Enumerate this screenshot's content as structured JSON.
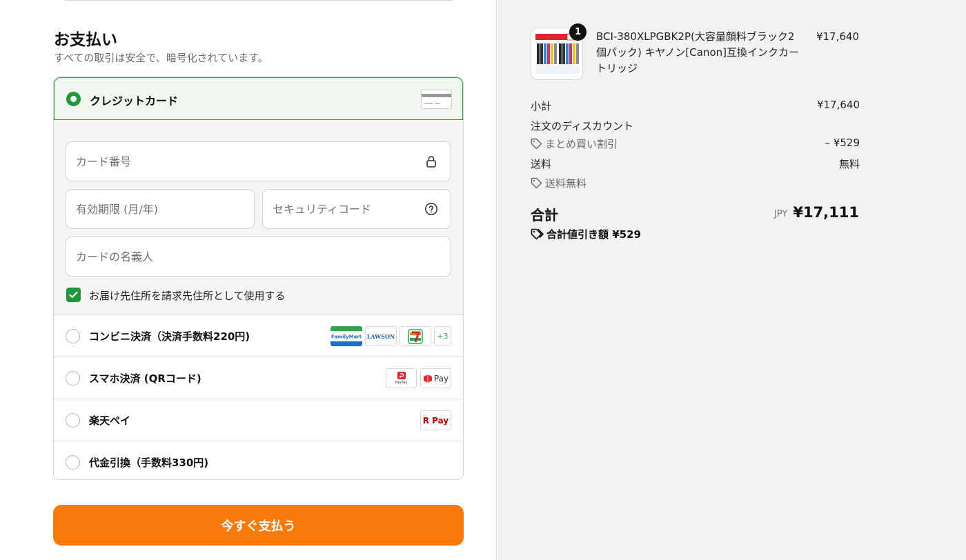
{
  "payment": {
    "title": "お支払い",
    "subtitle": "すべての取引は安全で、暗号化されています。",
    "credit_card": {
      "label": "クレジットカード",
      "card_number_placeholder": "カード番号",
      "expiry_placeholder": "有効期限 (月/年)",
      "cvc_placeholder": "セキュリティコード",
      "name_placeholder": "カードの名義人",
      "billing_same_label": "お届け先住所を請求先住所として使用する"
    },
    "options": [
      {
        "label": "コンビニ決済（決済手数料220円)",
        "logos": [
          "FamilyMart",
          "LAWSON",
          "7-Eleven",
          "+3"
        ]
      },
      {
        "label": "スマホ決済 (QRコード)",
        "logos": [
          "PayPay",
          "Pay"
        ]
      },
      {
        "label": "楽天ペイ",
        "logos": [
          "R Pay"
        ]
      },
      {
        "label": "代金引換（手数料330円)",
        "logos": []
      }
    ],
    "pay_button": "今すぐ支払う"
  },
  "summary": {
    "item": {
      "quantity": "1",
      "name": "BCI-380XLPGBK2P(大容量顔料ブラック2個パック) キヤノン[Canon]互換インクカートリッジ",
      "price": "¥17,640"
    },
    "subtotal_label": "小計",
    "subtotal_value": "¥17,640",
    "discount_label": "注文のディスカウント",
    "discount_name": "まとめ買い割引",
    "discount_value": "– ¥529",
    "shipping_label": "送料",
    "shipping_value": "無料",
    "shipping_note": "送料無料",
    "total_label": "合計",
    "currency": "JPY",
    "total_value": "¥17,111",
    "total_savings": "合計値引き額 ¥529"
  },
  "colors": {
    "accent_green": "#24963a",
    "button_orange": "#f77b0b",
    "summary_bg": "#f2f2f2"
  }
}
